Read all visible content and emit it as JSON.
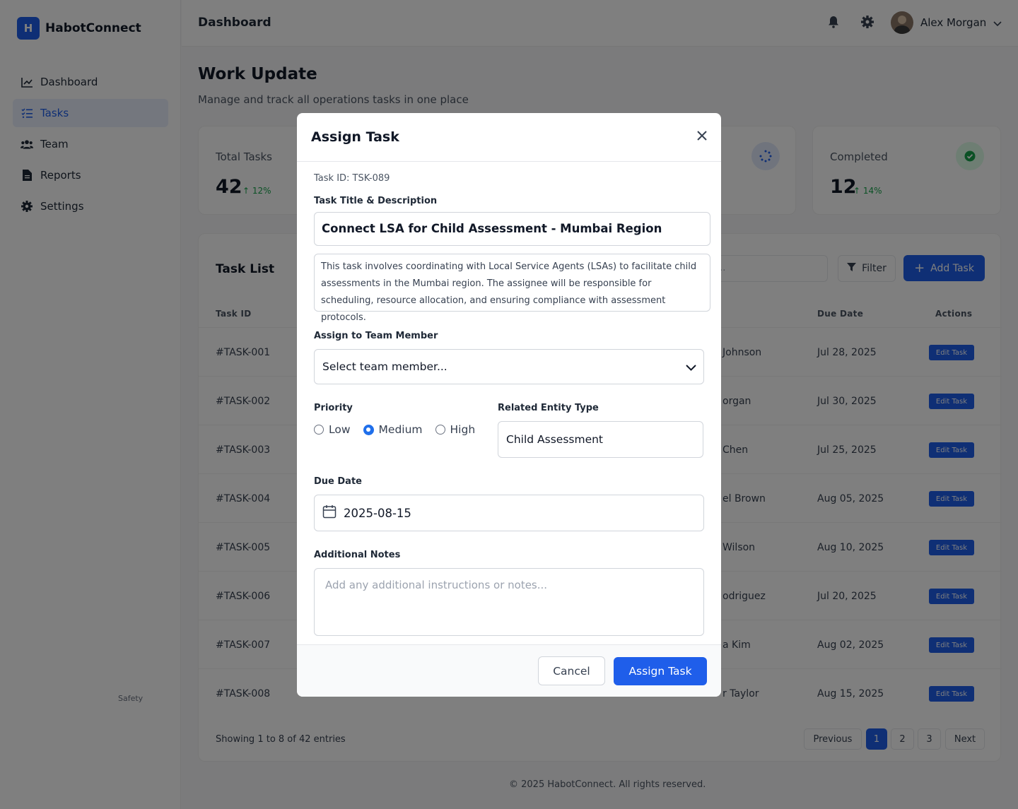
{
  "brand": {
    "logo_letter": "H",
    "name": "HabotConnect"
  },
  "sidebar": {
    "items": [
      {
        "label": "Dashboard",
        "icon": "chart-line-icon",
        "active": false
      },
      {
        "label": "Tasks",
        "icon": "tasks-icon",
        "active": true
      },
      {
        "label": "Team",
        "icon": "users-icon",
        "active": false
      },
      {
        "label": "Reports",
        "icon": "file-icon",
        "active": false
      },
      {
        "label": "Settings",
        "icon": "gear-icon",
        "active": false
      }
    ]
  },
  "topbar": {
    "title": "Dashboard",
    "user_name": "Alex Morgan"
  },
  "page": {
    "title": "Work Update",
    "subtitle": "Manage and track all operations tasks in one place"
  },
  "stats": {
    "total": {
      "label": "Total Tasks",
      "value": "42",
      "change": "12%"
    },
    "completed": {
      "label": "Completed",
      "value": "12",
      "change": "14%"
    }
  },
  "table": {
    "title": "Task List",
    "search_placeholder": "...",
    "filter_label": "Filter",
    "add_label": "Add Task",
    "headers": {
      "id": "Task ID",
      "due": "Due Date",
      "actions": "Actions"
    },
    "rows": [
      {
        "id": "#TASK-001",
        "assignee": "Johnson",
        "due": "Jul 28, 2025",
        "action": "Edit Task"
      },
      {
        "id": "#TASK-002",
        "assignee": "organ",
        "due": "Jul 30, 2025",
        "action": "Edit Task"
      },
      {
        "id": "#TASK-003",
        "assignee": "Chen",
        "due": "Jul 25, 2025",
        "action": "Edit Task"
      },
      {
        "id": "#TASK-004",
        "assignee": "el Brown",
        "due": "Aug 05, 2025",
        "action": "Edit Task"
      },
      {
        "id": "#TASK-005",
        "assignee": "Wilson",
        "due": "Aug 10, 2025",
        "action": "Edit Task"
      },
      {
        "id": "#TASK-006",
        "assignee": "odriguez",
        "due": "Jul 20, 2025",
        "action": "Edit Task"
      },
      {
        "id": "#TASK-007",
        "assignee": "a Kim",
        "due": "Aug 02, 2025",
        "action": "Edit Task"
      },
      {
        "id": "#TASK-008",
        "assignee": "r Taylor",
        "due": "Aug 15, 2025",
        "action": "Edit Task"
      }
    ],
    "row8_category": "Safety",
    "showing": "Showing 1 to 8 of 42 entries",
    "pagination": {
      "previous": "Previous",
      "pages": [
        "1",
        "2",
        "3"
      ],
      "current": "1",
      "next": "Next"
    }
  },
  "footer": "© 2025 HabotConnect. All rights reserved.",
  "modal": {
    "title": "Assign Task",
    "task_id": "Task ID: TSK-089",
    "title_label": "Task Title & Description",
    "task_title": "Connect LSA for Child Assessment - Mumbai Region",
    "description": "This task involves coordinating with Local Service Agents (LSAs) to facilitate child assessments in the Mumbai region. The assignee will be responsible for scheduling, resource allocation, and ensuring compliance with assessment protocols.",
    "assign_label": "Assign to Team Member",
    "assign_value": "Select team member...",
    "priority_label": "Priority",
    "priority_options": [
      "Low",
      "Medium",
      "High"
    ],
    "priority_selected": "Medium",
    "entity_label": "Related Entity Type",
    "entity_value": "Child Assessment",
    "due_label": "Due Date",
    "due_value": "2025-08-15",
    "notes_label": "Additional Notes",
    "notes_placeholder": "Add any additional instructions or notes...",
    "cancel": "Cancel",
    "submit": "Assign Task"
  },
  "colors": {
    "accent": "#1f5eea",
    "success": "#16a34a",
    "overlay": "rgba(0,0,0,0.5)"
  }
}
